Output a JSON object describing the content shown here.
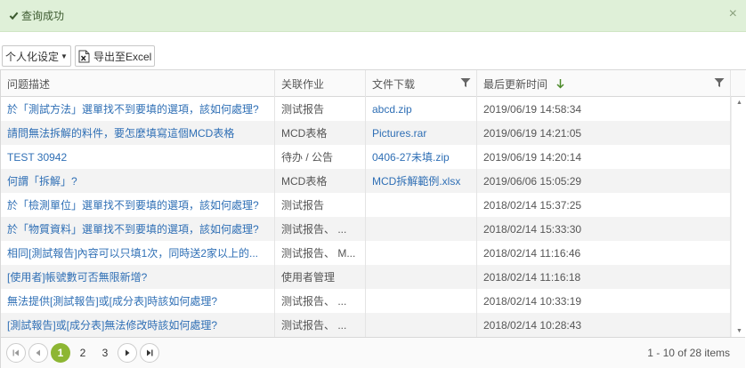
{
  "alert": {
    "message": "查询成功",
    "close": "×"
  },
  "toolbar": {
    "personalize_label": "个人化设定",
    "export_label": "导出至Excel"
  },
  "columns": [
    {
      "label": "问题描述"
    },
    {
      "label": "关联作业"
    },
    {
      "label": "文件下载"
    },
    {
      "label": "最后更新时间"
    }
  ],
  "rows": [
    {
      "question": "於「測試方法」選單找不到要填的選項，該如何處理?",
      "job": "测试报告",
      "file": "abcd.zip",
      "updated": "2019/06/19 14:58:34"
    },
    {
      "question": "請問無法拆解的料件，要怎麼填寫這個MCD表格",
      "job": "MCD表格",
      "file": "Pictures.rar",
      "updated": "2019/06/19 14:21:05"
    },
    {
      "question": "TEST 30942",
      "job": "待办 / 公告",
      "file": "0406-27未填.zip",
      "updated": "2019/06/19 14:20:14"
    },
    {
      "question": "何謂「拆解」?",
      "job": "MCD表格",
      "file": "MCD拆解範例.xlsx",
      "updated": "2019/06/06 15:05:29"
    },
    {
      "question": "於「檢測單位」選單找不到要填的選項，該如何處理?",
      "job": "测试报告",
      "file": "",
      "updated": "2018/02/14 15:37:25"
    },
    {
      "question": "於「物質資料」選單找不到要填的選項，該如何處理?",
      "job": "测试报告、 ...",
      "file": "",
      "updated": "2018/02/14 15:33:30"
    },
    {
      "question": "相同[測試報告]內容可以只填1次，同時送2家以上的...",
      "job": "测试报告、 M...",
      "file": "",
      "updated": "2018/02/14 11:16:46"
    },
    {
      "question": "[使用者]帳號數可否無限新增?",
      "job": "使用者管理",
      "file": "",
      "updated": "2018/02/14 11:16:18"
    },
    {
      "question": "無法提供[測試報告]或[成分表]時該如何處理?",
      "job": "测试报告、 ...",
      "file": "",
      "updated": "2018/02/14 10:33:19"
    },
    {
      "question": "[測試報告]或[成分表]無法修改時該如何處理?",
      "job": "测试报告、 ...",
      "file": "",
      "updated": "2018/02/14 10:28:43"
    }
  ],
  "pager": {
    "pages": [
      "1",
      "2",
      "3"
    ],
    "current": "1",
    "info": "1 - 10 of 28 items"
  },
  "colors": {
    "accent": "#8db633",
    "link": "#2f6fb5",
    "alert_bg": "#dff0d8"
  }
}
